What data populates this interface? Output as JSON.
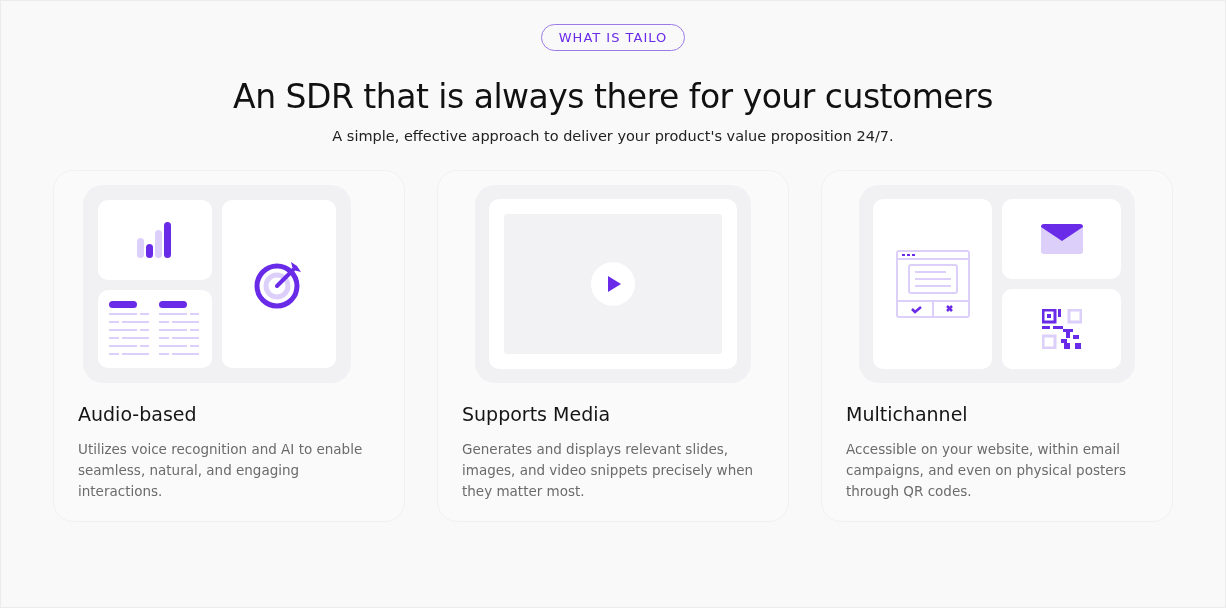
{
  "badge": "WHAT IS TAILO",
  "heading": "An SDR that is always there for your customers",
  "subheading": "A simple, effective approach to deliver your product's value proposition 24/7.",
  "features": [
    {
      "kind": "audio",
      "title": "Audio-based",
      "description": "Utilizes voice recognition and AI to enable seamless, natural, and engaging interactions."
    },
    {
      "kind": "media",
      "title": "Supports Media",
      "description": "Generates and displays relevant slides, images, and video snippets precisely when they matter most."
    },
    {
      "kind": "multichannel",
      "title": "Multichannel",
      "description": "Accessible on your website, within email campaigns, and even on physical posters through QR codes."
    }
  ]
}
